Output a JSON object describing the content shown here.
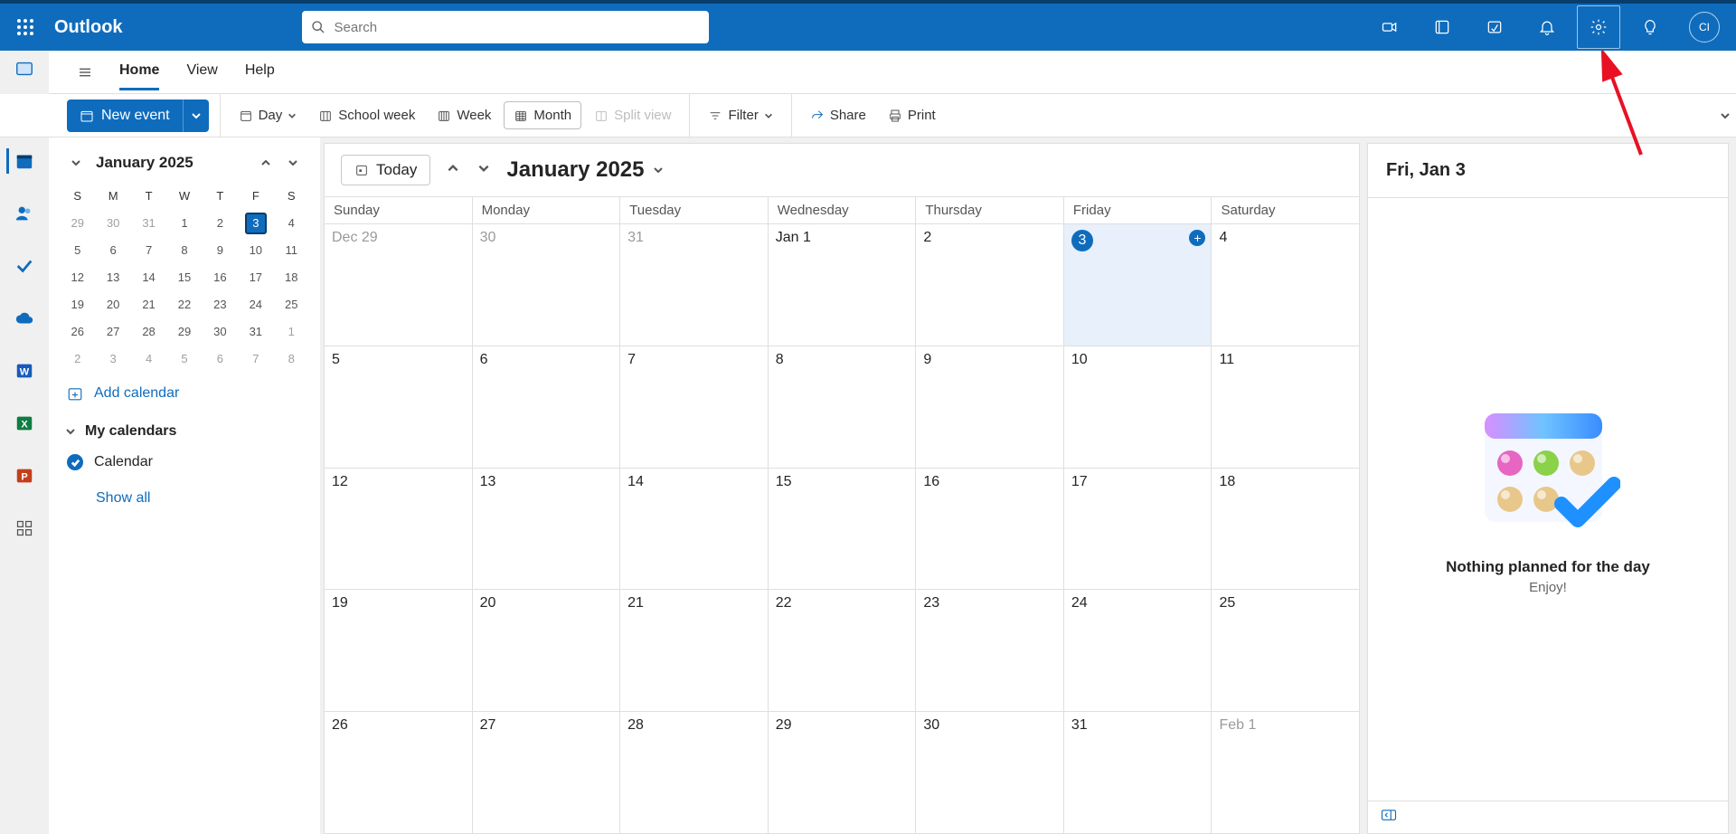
{
  "header": {
    "app_name": "Outlook",
    "search_placeholder": "Search",
    "avatar_initials": "CI"
  },
  "tabs": {
    "home": "Home",
    "view": "View",
    "help": "Help"
  },
  "toolbar": {
    "new_event": "New event",
    "day": "Day",
    "school_week": "School week",
    "week": "Week",
    "month": "Month",
    "split_view": "Split view",
    "filter": "Filter",
    "share": "Share",
    "print": "Print"
  },
  "mini": {
    "title": "January 2025",
    "dow": [
      "S",
      "M",
      "T",
      "W",
      "T",
      "F",
      "S"
    ],
    "weeks": [
      [
        {
          "n": "29",
          "dim": true
        },
        {
          "n": "30",
          "dim": true
        },
        {
          "n": "31",
          "dim": true
        },
        {
          "n": "1"
        },
        {
          "n": "2"
        },
        {
          "n": "3",
          "today": true
        },
        {
          "n": "4"
        }
      ],
      [
        {
          "n": "5"
        },
        {
          "n": "6"
        },
        {
          "n": "7"
        },
        {
          "n": "8"
        },
        {
          "n": "9"
        },
        {
          "n": "10"
        },
        {
          "n": "11"
        }
      ],
      [
        {
          "n": "12"
        },
        {
          "n": "13"
        },
        {
          "n": "14"
        },
        {
          "n": "15"
        },
        {
          "n": "16"
        },
        {
          "n": "17"
        },
        {
          "n": "18"
        }
      ],
      [
        {
          "n": "19"
        },
        {
          "n": "20"
        },
        {
          "n": "21"
        },
        {
          "n": "22"
        },
        {
          "n": "23"
        },
        {
          "n": "24"
        },
        {
          "n": "25"
        }
      ],
      [
        {
          "n": "26"
        },
        {
          "n": "27"
        },
        {
          "n": "28"
        },
        {
          "n": "29"
        },
        {
          "n": "30"
        },
        {
          "n": "31"
        },
        {
          "n": "1",
          "dim": true
        }
      ],
      [
        {
          "n": "2",
          "dim": true
        },
        {
          "n": "3",
          "dim": true
        },
        {
          "n": "4",
          "dim": true
        },
        {
          "n": "5",
          "dim": true
        },
        {
          "n": "6",
          "dim": true
        },
        {
          "n": "7",
          "dim": true
        },
        {
          "n": "8",
          "dim": true
        }
      ]
    ],
    "add_calendar": "Add calendar",
    "my_calendars": "My calendars",
    "calendar_item": "Calendar",
    "show_all": "Show all"
  },
  "grid": {
    "today_btn": "Today",
    "month_title": "January 2025",
    "dow": [
      "Sunday",
      "Monday",
      "Tuesday",
      "Wednesday",
      "Thursday",
      "Friday",
      "Saturday"
    ],
    "weeks": [
      [
        {
          "n": "Dec 29",
          "dim": true
        },
        {
          "n": "30",
          "dim": true
        },
        {
          "n": "31",
          "dim": true
        },
        {
          "n": "Jan 1"
        },
        {
          "n": "2"
        },
        {
          "n": "3",
          "today": true,
          "plus": true
        },
        {
          "n": "4"
        }
      ],
      [
        {
          "n": "5"
        },
        {
          "n": "6"
        },
        {
          "n": "7"
        },
        {
          "n": "8"
        },
        {
          "n": "9"
        },
        {
          "n": "10"
        },
        {
          "n": "11"
        }
      ],
      [
        {
          "n": "12"
        },
        {
          "n": "13"
        },
        {
          "n": "14"
        },
        {
          "n": "15"
        },
        {
          "n": "16"
        },
        {
          "n": "17"
        },
        {
          "n": "18"
        }
      ],
      [
        {
          "n": "19"
        },
        {
          "n": "20"
        },
        {
          "n": "21"
        },
        {
          "n": "22"
        },
        {
          "n": "23"
        },
        {
          "n": "24"
        },
        {
          "n": "25"
        }
      ],
      [
        {
          "n": "26"
        },
        {
          "n": "27"
        },
        {
          "n": "28"
        },
        {
          "n": "29"
        },
        {
          "n": "30"
        },
        {
          "n": "31"
        },
        {
          "n": "Feb 1",
          "dim": true
        }
      ]
    ]
  },
  "agenda": {
    "title": "Fri, Jan 3",
    "line1": "Nothing planned for the day",
    "line2": "Enjoy!"
  }
}
